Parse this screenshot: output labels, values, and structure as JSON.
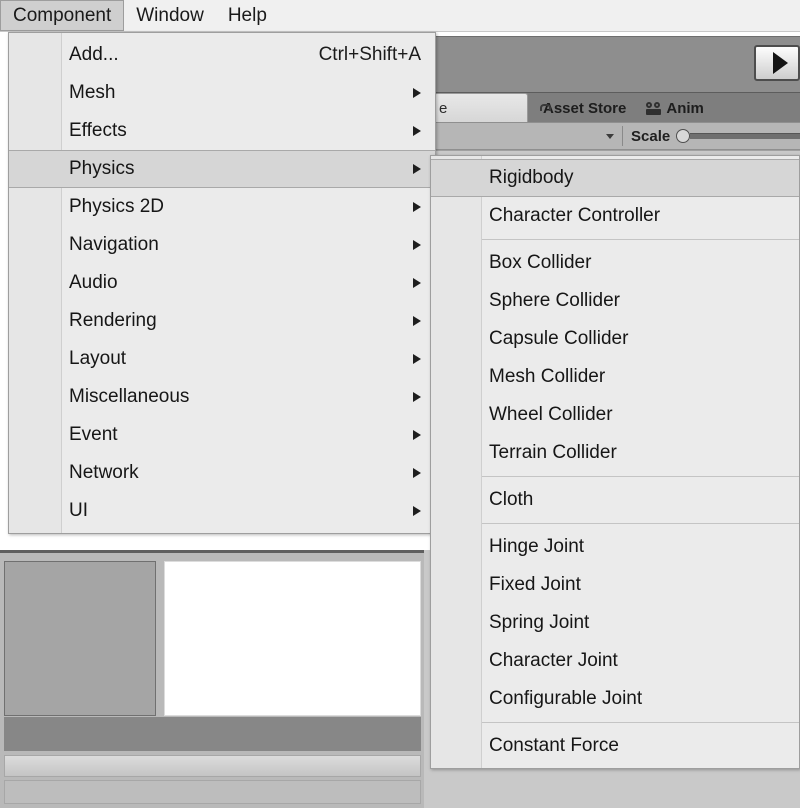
{
  "menubar": {
    "items": [
      {
        "label": "Component",
        "active": true
      },
      {
        "label": "Window",
        "active": false
      },
      {
        "label": "Help",
        "active": false
      }
    ]
  },
  "component_menu": {
    "items": [
      {
        "label": "Add...",
        "shortcut": "Ctrl+Shift+A",
        "has_submenu": false,
        "selected": false
      },
      {
        "label": "Mesh",
        "shortcut": "",
        "has_submenu": true,
        "selected": false
      },
      {
        "label": "Effects",
        "shortcut": "",
        "has_submenu": true,
        "selected": false
      },
      {
        "label": "Physics",
        "shortcut": "",
        "has_submenu": true,
        "selected": true
      },
      {
        "label": "Physics 2D",
        "shortcut": "",
        "has_submenu": true,
        "selected": false
      },
      {
        "label": "Navigation",
        "shortcut": "",
        "has_submenu": true,
        "selected": false
      },
      {
        "label": "Audio",
        "shortcut": "",
        "has_submenu": true,
        "selected": false
      },
      {
        "label": "Rendering",
        "shortcut": "",
        "has_submenu": true,
        "selected": false
      },
      {
        "label": "Layout",
        "shortcut": "",
        "has_submenu": true,
        "selected": false
      },
      {
        "label": "Miscellaneous",
        "shortcut": "",
        "has_submenu": true,
        "selected": false
      },
      {
        "label": "Event",
        "shortcut": "",
        "has_submenu": true,
        "selected": false
      },
      {
        "label": "Network",
        "shortcut": "",
        "has_submenu": true,
        "selected": false
      },
      {
        "label": "UI",
        "shortcut": "",
        "has_submenu": true,
        "selected": false
      }
    ]
  },
  "physics_submenu": {
    "items": [
      {
        "label": "Rigidbody",
        "selected": true,
        "separator_after": false
      },
      {
        "label": "Character Controller",
        "selected": false,
        "separator_after": true
      },
      {
        "label": "Box Collider",
        "selected": false,
        "separator_after": false
      },
      {
        "label": "Sphere Collider",
        "selected": false,
        "separator_after": false
      },
      {
        "label": "Capsule Collider",
        "selected": false,
        "separator_after": false
      },
      {
        "label": "Mesh Collider",
        "selected": false,
        "separator_after": false
      },
      {
        "label": "Wheel Collider",
        "selected": false,
        "separator_after": false
      },
      {
        "label": "Terrain Collider",
        "selected": false,
        "separator_after": true
      },
      {
        "label": "Cloth",
        "selected": false,
        "separator_after": true
      },
      {
        "label": "Hinge Joint",
        "selected": false,
        "separator_after": false
      },
      {
        "label": "Fixed Joint",
        "selected": false,
        "separator_after": false
      },
      {
        "label": "Spring Joint",
        "selected": false,
        "separator_after": false
      },
      {
        "label": "Character Joint",
        "selected": false,
        "separator_after": false
      },
      {
        "label": "Configurable Joint",
        "selected": false,
        "separator_after": true
      },
      {
        "label": "Constant Force",
        "selected": false,
        "separator_after": false
      }
    ]
  },
  "editor_background": {
    "tabs": [
      {
        "label": "e",
        "icon": "",
        "active": true
      },
      {
        "label": "Asset Store",
        "icon": "bag-icon",
        "active": false
      },
      {
        "label": "Anim",
        "icon": "animation-icon",
        "active": false
      }
    ],
    "scale_label": "Scale",
    "play_button_icon": "play-icon"
  },
  "colors": {
    "menu_background": "#ebebeb",
    "menu_highlight": "#d6d6d6",
    "menu_border": "#9e9e9e",
    "menubar_active": "#cfcfcf",
    "editor_toolbar": "#8e8e8e",
    "editor_tabbar": "#7e7e7e",
    "text": "#161616"
  }
}
